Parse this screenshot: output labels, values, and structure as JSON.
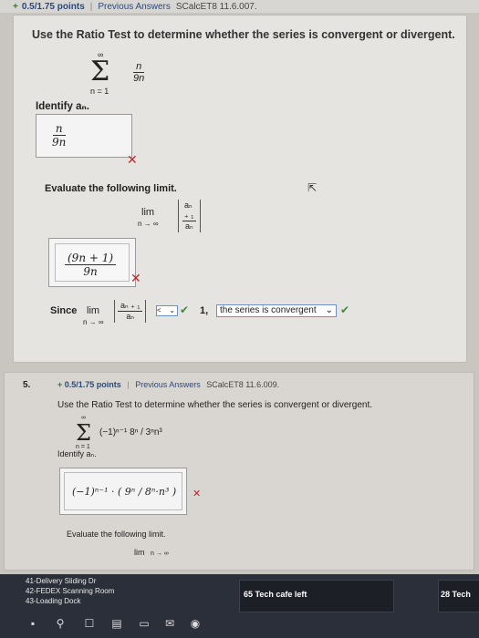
{
  "question4": {
    "score": "0.5/1.75 points",
    "previous_answers": "Previous Answers",
    "ref": "SCalcET8 11.6.007.",
    "prompt": "Use the Ratio Test to determine whether the series is convergent or divergent.",
    "series_upper": "∞",
    "series_lower": "n = 1",
    "series_num": "n",
    "series_den": "9n",
    "identify_label": "Identify aₙ.",
    "answer_an_num": "n",
    "answer_an_den": "9n",
    "evaluate_label": "Evaluate the following limit.",
    "lim_word": "lim",
    "lim_sub": "n → ∞",
    "ratio_num": "aₙ ₊ ₁",
    "ratio_den": "aₙ",
    "answer_limit_num": "(9n + 1)",
    "answer_limit_den": "9n",
    "since_label": "Since",
    "compare_select": "<",
    "one_label": "1,",
    "conclusion_select": "the series is convergent"
  },
  "question5": {
    "number": "5.",
    "score": "0.5/1.75 points",
    "previous_answers": "Previous Answers",
    "ref": "SCalcET8 11.6.009.",
    "prompt": "Use the Ratio Test to determine whether the series is convergent or divergent.",
    "series_upper": "∞",
    "series_lower": "n = 1",
    "series_term": "(−1)ⁿ⁻¹ 8ⁿ / 3ⁿn³",
    "identify_label": "Identify aₙ.",
    "answer_an": "(−1)ⁿ⁻¹ · ( 9ⁿ / 8ⁿ·n³ )",
    "evaluate_label": "Evaluate the following limit.",
    "lim_word": "lim",
    "lim_sub": "n → ∞"
  },
  "taskbar": {
    "notes": [
      "41-Delivery Sliding Dr",
      "42-FEDEX Scanning Room",
      "43-Loading Dock"
    ],
    "tile1_label": "65 Tech cafe left",
    "tile2_label": "28 Tech"
  },
  "colors": {
    "wrong": "#c0262d",
    "correct": "#3a8e3a",
    "link": "#2b4a7a"
  }
}
